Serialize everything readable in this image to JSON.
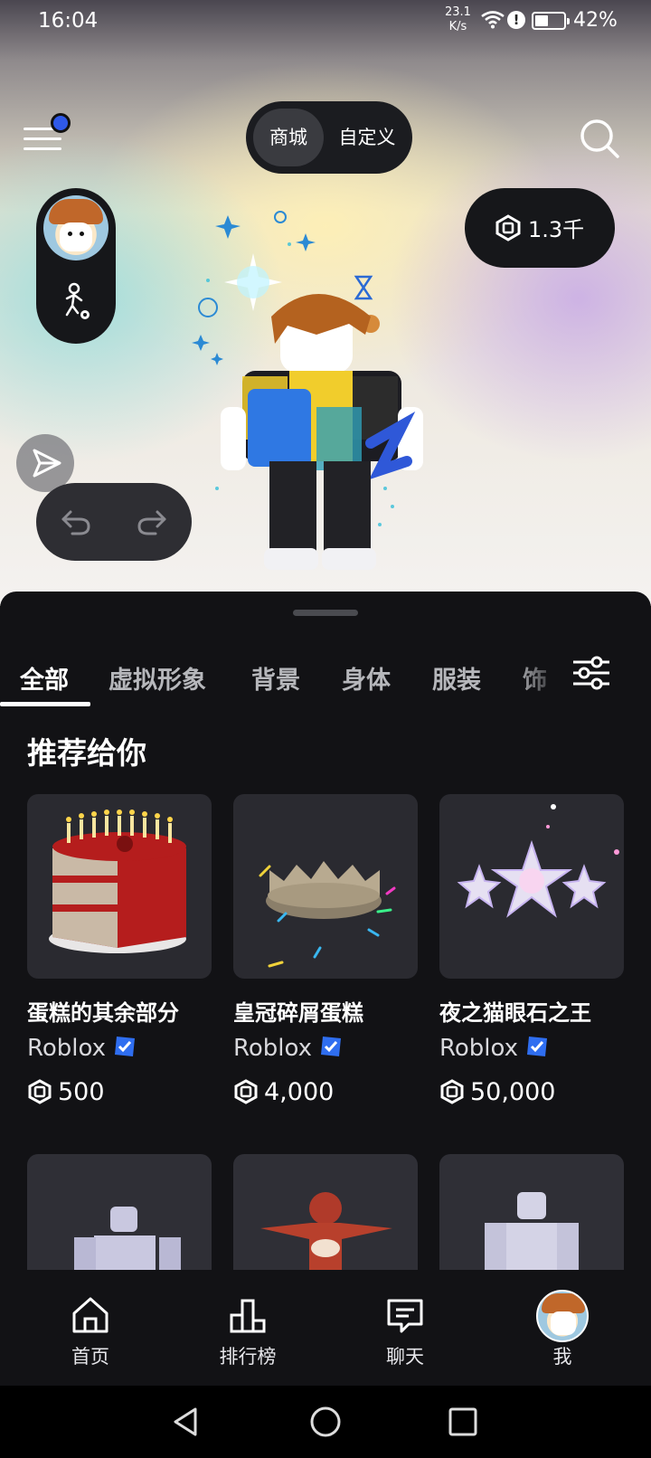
{
  "status_bar": {
    "time": "16:04",
    "net_speed_value": "23.1",
    "net_speed_unit": "K/s",
    "alert": "!",
    "battery": "42%"
  },
  "header": {
    "segment_active": "商城",
    "segment_other": "自定义",
    "robux_balance": "1.3千"
  },
  "tabs": [
    "全部",
    "虚拟形象",
    "背景",
    "身体",
    "服装",
    "饰"
  ],
  "section_title": "推荐给你",
  "items": [
    {
      "name": "蛋糕的其余部分",
      "creator": "Roblox",
      "price": "500"
    },
    {
      "name": "皇冠碎屑蛋糕",
      "creator": "Roblox",
      "price": "4,000"
    },
    {
      "name": "夜之猫眼石之王",
      "creator": "Roblox",
      "price": "50,000"
    }
  ],
  "bottom_nav": [
    "首页",
    "排行榜",
    "聊天",
    "我"
  ],
  "colors": {
    "background": "#121215",
    "accent_blue": "#2f59e8",
    "pill_dark": "#16171a",
    "card_bg": "#2a2a30"
  }
}
